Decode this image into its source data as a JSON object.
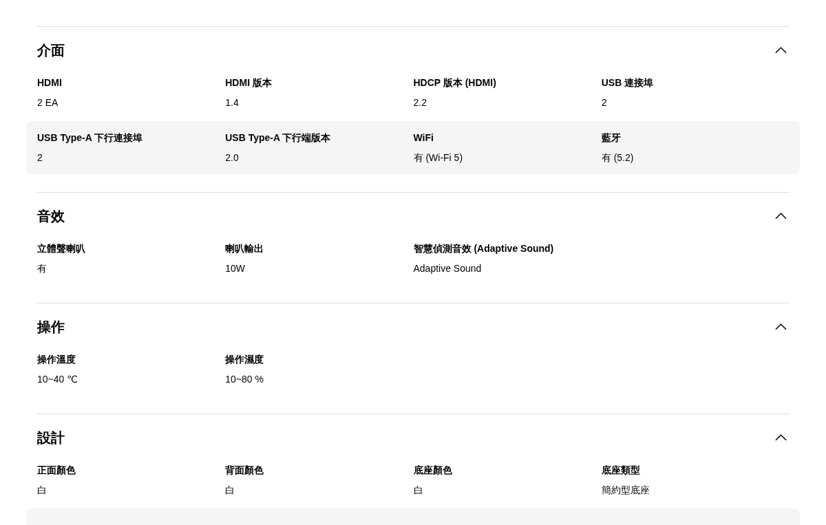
{
  "sections": [
    {
      "title": "介面",
      "expanded": true,
      "rows": [
        [
          {
            "label": "HDMI",
            "value": "2 EA"
          },
          {
            "label": "HDMI 版本",
            "value": "1.4"
          },
          {
            "label": "HDCP 版本 (HDMI)",
            "value": "2.2"
          },
          {
            "label": "USB 連接埠",
            "value": "2"
          }
        ],
        [
          {
            "label": "USB Type-A 下行連接埠",
            "value": "2"
          },
          {
            "label": "USB Type-A 下行端版本",
            "value": "2.0"
          },
          {
            "label": "WiFi",
            "value": "有 (Wi-Fi 5)"
          },
          {
            "label": "藍牙",
            "value": "有 (5.2)"
          }
        ]
      ]
    },
    {
      "title": "音效",
      "expanded": true,
      "rows": [
        [
          {
            "label": "立體聲喇叭",
            "value": "有"
          },
          {
            "label": "喇叭輸出",
            "value": "10W"
          },
          {
            "label": "智慧偵測音效 (Adaptive Sound)",
            "value": "Adaptive Sound"
          }
        ]
      ]
    },
    {
      "title": "操作",
      "expanded": true,
      "rows": [
        [
          {
            "label": "操作溫度",
            "value": "10~40 ℃"
          },
          {
            "label": "操作濕度",
            "value": "10~80 %"
          }
        ]
      ]
    },
    {
      "title": "設計",
      "expanded": true,
      "rows": [
        [
          {
            "label": "正面顏色",
            "value": "白"
          },
          {
            "label": "背面顏色",
            "value": "白"
          },
          {
            "label": "底座顏色",
            "value": "白"
          },
          {
            "label": "底座類型",
            "value": "簡約型底座"
          }
        ],
        [
          {},
          {}
        ]
      ]
    }
  ]
}
